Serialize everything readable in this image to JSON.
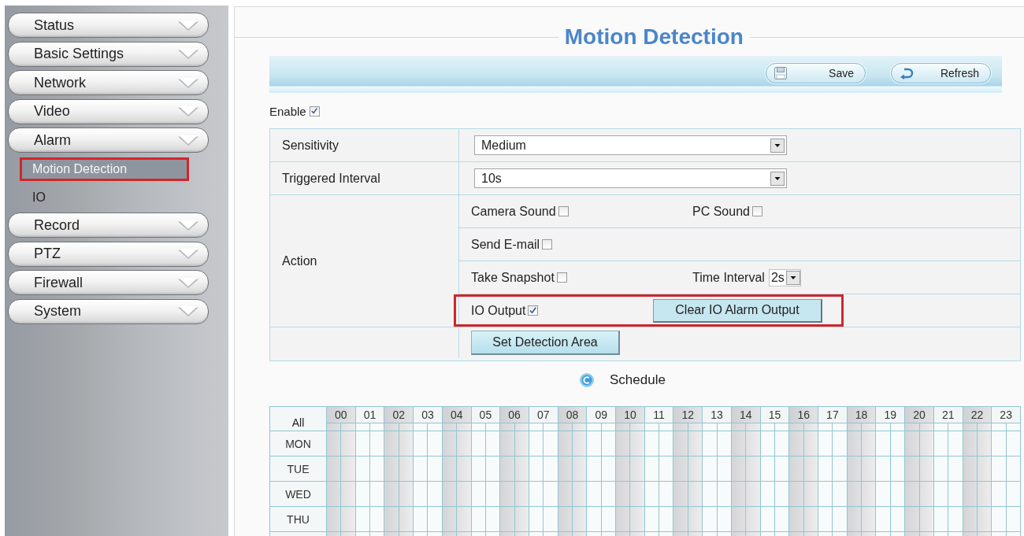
{
  "sidebar": {
    "items": [
      {
        "label": "Status"
      },
      {
        "label": "Basic Settings"
      },
      {
        "label": "Network"
      },
      {
        "label": "Video"
      },
      {
        "label": "Alarm",
        "children": [
          {
            "label": "Motion Detection",
            "selected": true,
            "highlighted": true
          },
          {
            "label": "IO",
            "selected": false,
            "highlighted": false
          }
        ]
      },
      {
        "label": "Record"
      },
      {
        "label": "PTZ"
      },
      {
        "label": "Firewall"
      },
      {
        "label": "System"
      }
    ]
  },
  "page": {
    "title": "Motion Detection"
  },
  "toolbar": {
    "buttons": [
      {
        "kind": "save",
        "label": "Save"
      },
      {
        "kind": "refresh",
        "label": "Refresh"
      }
    ]
  },
  "enable": {
    "label": "Enable",
    "checked": true
  },
  "settings": [
    {
      "label": "Sensitivity",
      "value": "Medium"
    },
    {
      "label": "Triggered Interval",
      "value": "10s"
    }
  ],
  "action": {
    "label": "Action",
    "rows": [
      {
        "highlighted": false,
        "items": [
          {
            "kind": "checkbox",
            "label": "Camera Sound",
            "checked": false
          },
          {
            "kind": "checkbox",
            "label": "PC Sound",
            "checked": false
          }
        ]
      },
      {
        "highlighted": false,
        "items": [
          {
            "kind": "checkbox",
            "label": "Send E-mail",
            "checked": false
          }
        ]
      },
      {
        "highlighted": false,
        "items": [
          {
            "kind": "checkbox",
            "label": "Take Snapshot",
            "checked": false
          },
          {
            "kind": "select",
            "label": "Time Interval",
            "value": "2s"
          }
        ]
      },
      {
        "highlighted": true,
        "items": [
          {
            "kind": "checkbox",
            "label": "IO Output",
            "checked": true
          },
          {
            "kind": "button",
            "label": "Clear IO Alarm Output"
          }
        ]
      }
    ]
  },
  "detection_area": {
    "button": "Set Detection Area"
  },
  "schedule": {
    "label": "Schedule",
    "all_label": "All",
    "hours": [
      "00",
      "01",
      "02",
      "03",
      "04",
      "05",
      "06",
      "07",
      "08",
      "09",
      "10",
      "11",
      "12",
      "13",
      "14",
      "15",
      "16",
      "17",
      "18",
      "19",
      "20",
      "21",
      "22",
      "23"
    ],
    "days": [
      "MON",
      "TUE",
      "WED",
      "THU"
    ]
  }
}
